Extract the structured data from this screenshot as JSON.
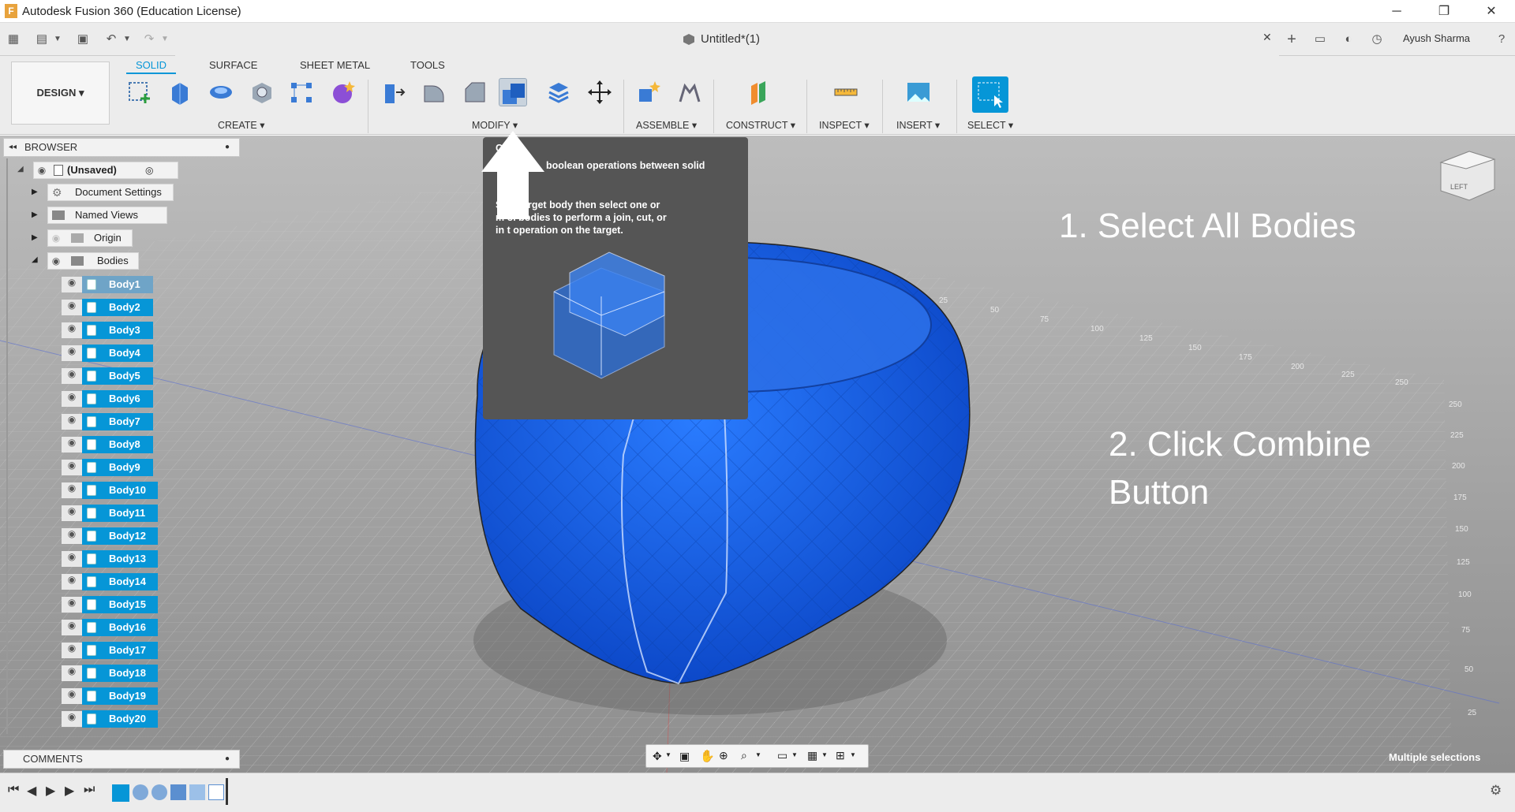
{
  "window": {
    "title": "Autodesk Fusion 360 (Education License)",
    "minimize": "─",
    "restore": "❐",
    "close": "✕",
    "logo_letter": "F"
  },
  "document": {
    "tab_label": "Untitled*(1)",
    "close": "✕"
  },
  "user": {
    "name": "Ayush Sharma"
  },
  "ribbon": {
    "workspace": "DESIGN ▾",
    "tabs": [
      {
        "label": "SOLID",
        "active": true
      },
      {
        "label": "SURFACE"
      },
      {
        "label": "SHEET METAL"
      },
      {
        "label": "TOOLS"
      }
    ],
    "groups": {
      "create": "CREATE ▾",
      "modify": "MODIFY ▾",
      "assemble": "ASSEMBLE ▾",
      "construct": "CONSTRUCT ▾",
      "inspect": "INSPECT ▾",
      "insert": "INSERT ▾",
      "select": "SELECT ▾"
    }
  },
  "browser": {
    "title": "BROWSER",
    "root": "(Unsaved)",
    "folders": [
      "Document Settings",
      "Named Views",
      "Origin",
      "Bodies"
    ],
    "bodies": [
      "Body1",
      "Body2",
      "Body3",
      "Body4",
      "Body5",
      "Body6",
      "Body7",
      "Body8",
      "Body9",
      "Body10",
      "Body11",
      "Body12",
      "Body13",
      "Body14",
      "Body15",
      "Body16",
      "Body17",
      "Body18",
      "Body19",
      "Body20"
    ]
  },
  "comments": {
    "title": "COMMENTS"
  },
  "tooltip": {
    "title_fragment": "C        e",
    "line1": "boolean operations between solid",
    "line2": "S       he target body then select one or",
    "line3": "m       ol bodies to perform a join, cut, or",
    "line4": "in        t operation on the target."
  },
  "annotations": {
    "step1": "1. Select All Bodies",
    "step2_line1": "2. Click Combine",
    "step2_line2": "Button"
  },
  "viewcube": {
    "face": "LEFT"
  },
  "grid_labels": {
    "top": [
      "25",
      "50",
      "75",
      "100",
      "125",
      "150",
      "175",
      "200",
      "225",
      "250"
    ],
    "right": [
      "250",
      "225",
      "200",
      "175",
      "150",
      "125",
      "100",
      "75",
      "50",
      "25"
    ]
  },
  "status": {
    "selection": "Multiple selections"
  },
  "colors": {
    "accent": "#0696d7",
    "body_blue": "#1a6cf0",
    "tooltip_bg": "#555555"
  }
}
